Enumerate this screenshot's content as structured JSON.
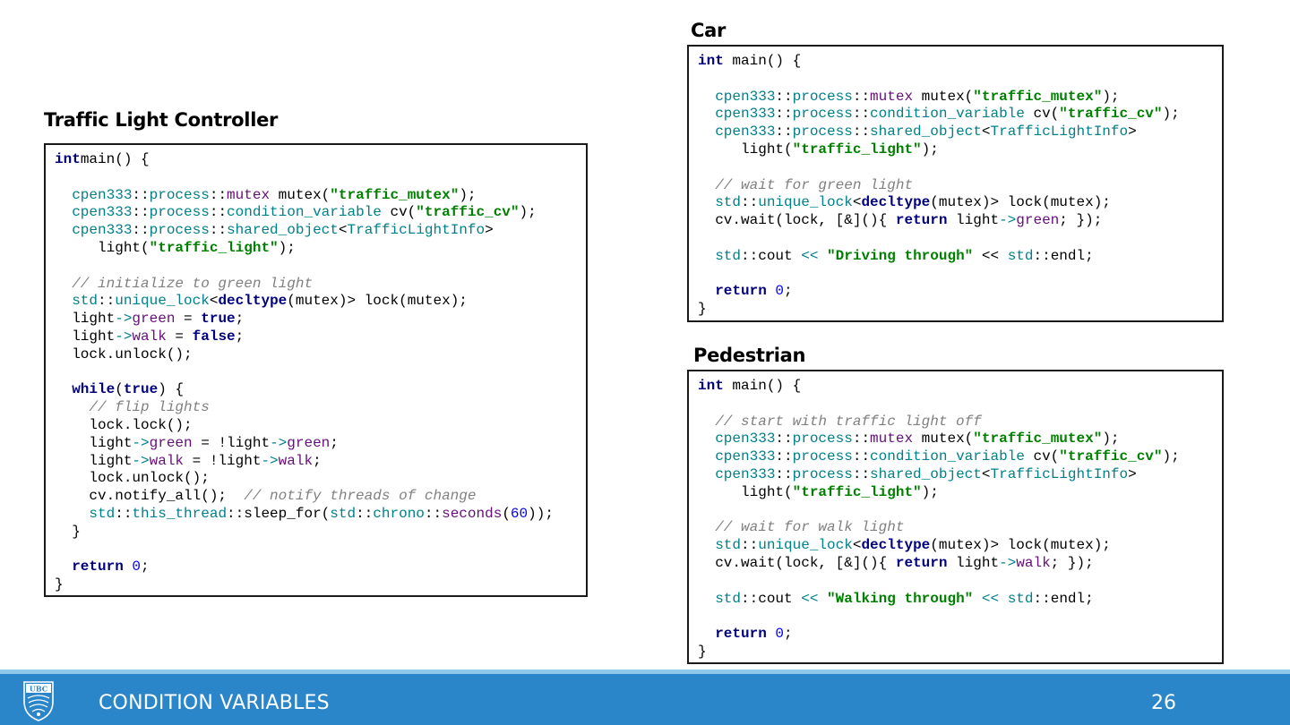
{
  "panels": {
    "controller": {
      "title": "Traffic Light Controller"
    },
    "car": {
      "title": "Car"
    },
    "pedestrian": {
      "title": "Pedestrian"
    }
  },
  "code": {
    "controller": [
      [
        [
          "kw",
          "int"
        ],
        [
          "",
          "main() {"
        ]
      ],
      [],
      [
        [
          "",
          "  "
        ],
        [
          "ns",
          "cpen333"
        ],
        [
          "",
          "::"
        ],
        [
          "ns",
          "process"
        ],
        [
          "",
          "::"
        ],
        [
          "mem",
          "mutex"
        ],
        [
          "",
          " mutex("
        ],
        [
          "str",
          "\"traffic_mutex\""
        ],
        [
          "",
          ");"
        ]
      ],
      [
        [
          "",
          "  "
        ],
        [
          "ns",
          "cpen333"
        ],
        [
          "",
          "::"
        ],
        [
          "ns",
          "process"
        ],
        [
          "",
          "::"
        ],
        [
          "ns",
          "condition_variable"
        ],
        [
          "",
          " cv("
        ],
        [
          "str",
          "\"traffic_cv\""
        ],
        [
          "",
          ");"
        ]
      ],
      [
        [
          "",
          "  "
        ],
        [
          "ns",
          "cpen333"
        ],
        [
          "",
          "::"
        ],
        [
          "ns",
          "process"
        ],
        [
          "",
          "::"
        ],
        [
          "ns",
          "shared_object"
        ],
        [
          "",
          "<"
        ],
        [
          "ns",
          "TrafficLightInfo"
        ],
        [
          "",
          ">"
        ]
      ],
      [
        [
          "",
          "     light("
        ],
        [
          "str",
          "\"traffic_light\""
        ],
        [
          "",
          ");"
        ]
      ],
      [],
      [
        [
          "",
          "  "
        ],
        [
          "cmt",
          "// initialize to green light"
        ]
      ],
      [
        [
          "",
          "  "
        ],
        [
          "ns",
          "std"
        ],
        [
          "",
          "::"
        ],
        [
          "ns",
          "unique_lock"
        ],
        [
          "",
          "<"
        ],
        [
          "kw",
          "decltype"
        ],
        [
          "",
          "(mutex)> lock(mutex);"
        ]
      ],
      [
        [
          "",
          "  light"
        ],
        [
          "op",
          "->"
        ],
        [
          "mem",
          "green"
        ],
        [
          "",
          " = "
        ],
        [
          "kw",
          "true"
        ],
        [
          "",
          ";"
        ]
      ],
      [
        [
          "",
          "  light"
        ],
        [
          "op",
          "->"
        ],
        [
          "mem",
          "walk"
        ],
        [
          "",
          " = "
        ],
        [
          "kw",
          "false"
        ],
        [
          "",
          ";"
        ]
      ],
      [
        [
          "",
          "  lock.unlock();"
        ]
      ],
      [],
      [
        [
          "",
          "  "
        ],
        [
          "kw",
          "while"
        ],
        [
          "",
          "("
        ],
        [
          "kw",
          "true"
        ],
        [
          "",
          ") {"
        ]
      ],
      [
        [
          "",
          "    "
        ],
        [
          "cmt",
          "// flip lights"
        ]
      ],
      [
        [
          "",
          "    lock.lock();"
        ]
      ],
      [
        [
          "",
          "    light"
        ],
        [
          "op",
          "->"
        ],
        [
          "mem",
          "green"
        ],
        [
          "",
          " = !light"
        ],
        [
          "op",
          "->"
        ],
        [
          "mem",
          "green"
        ],
        [
          "",
          ";"
        ]
      ],
      [
        [
          "",
          "    light"
        ],
        [
          "op",
          "->"
        ],
        [
          "mem",
          "walk"
        ],
        [
          "",
          " = !light"
        ],
        [
          "op",
          "->"
        ],
        [
          "mem",
          "walk"
        ],
        [
          "",
          ";"
        ]
      ],
      [
        [
          "",
          "    lock.unlock();"
        ]
      ],
      [
        [
          "",
          "    cv.notify_all();  "
        ],
        [
          "cmt",
          "// notify threads of change"
        ]
      ],
      [
        [
          "",
          "    "
        ],
        [
          "ns",
          "std"
        ],
        [
          "",
          "::"
        ],
        [
          "ns",
          "this_thread"
        ],
        [
          "",
          "::sleep_for("
        ],
        [
          "ns",
          "std"
        ],
        [
          "",
          "::"
        ],
        [
          "ns",
          "chrono"
        ],
        [
          "",
          "::"
        ],
        [
          "mem",
          "seconds"
        ],
        [
          "",
          "("
        ],
        [
          "num",
          "60"
        ],
        [
          "",
          "));"
        ]
      ],
      [
        [
          "",
          "  }"
        ]
      ],
      [],
      [
        [
          "",
          "  "
        ],
        [
          "kw",
          "return"
        ],
        [
          "",
          " "
        ],
        [
          "num",
          "0"
        ],
        [
          "",
          ";"
        ]
      ],
      [
        [
          "",
          "}"
        ]
      ]
    ],
    "car": [
      [
        [
          "kw",
          "int"
        ],
        [
          "",
          " main() {"
        ]
      ],
      [],
      [
        [
          "",
          "  "
        ],
        [
          "ns",
          "cpen333"
        ],
        [
          "",
          "::"
        ],
        [
          "ns",
          "process"
        ],
        [
          "",
          "::"
        ],
        [
          "mem",
          "mutex"
        ],
        [
          "",
          " mutex("
        ],
        [
          "str",
          "\"traffic_mutex\""
        ],
        [
          "",
          ");"
        ]
      ],
      [
        [
          "",
          "  "
        ],
        [
          "ns",
          "cpen333"
        ],
        [
          "",
          "::"
        ],
        [
          "ns",
          "process"
        ],
        [
          "",
          "::"
        ],
        [
          "ns",
          "condition_variable"
        ],
        [
          "",
          " cv("
        ],
        [
          "str",
          "\"traffic_cv\""
        ],
        [
          "",
          ");"
        ]
      ],
      [
        [
          "",
          "  "
        ],
        [
          "ns",
          "cpen333"
        ],
        [
          "",
          "::"
        ],
        [
          "ns",
          "process"
        ],
        [
          "",
          "::"
        ],
        [
          "ns",
          "shared_object"
        ],
        [
          "",
          "<"
        ],
        [
          "ns",
          "TrafficLightInfo"
        ],
        [
          "",
          ">"
        ]
      ],
      [
        [
          "",
          "     light("
        ],
        [
          "str",
          "\"traffic_light\""
        ],
        [
          "",
          ");"
        ]
      ],
      [],
      [
        [
          "",
          "  "
        ],
        [
          "cmt",
          "// wait for green light"
        ]
      ],
      [
        [
          "",
          "  "
        ],
        [
          "ns",
          "std"
        ],
        [
          "",
          "::"
        ],
        [
          "ns",
          "unique_lock"
        ],
        [
          "",
          "<"
        ],
        [
          "kw",
          "decltype"
        ],
        [
          "",
          "(mutex)> lock(mutex);"
        ]
      ],
      [
        [
          "",
          "  cv.wait(lock, [&](){ "
        ],
        [
          "kw",
          "return"
        ],
        [
          "",
          " light"
        ],
        [
          "op",
          "->"
        ],
        [
          "mem",
          "green"
        ],
        [
          "",
          "; });"
        ]
      ],
      [],
      [
        [
          "",
          "  "
        ],
        [
          "ns",
          "std"
        ],
        [
          "",
          "::cout "
        ],
        [
          "op",
          "<<"
        ],
        [
          "",
          " "
        ],
        [
          "str",
          "\"Driving through\""
        ],
        [
          "",
          " << "
        ],
        [
          "ns",
          "std"
        ],
        [
          "",
          "::endl;"
        ]
      ],
      [],
      [
        [
          "",
          "  "
        ],
        [
          "kw",
          "return"
        ],
        [
          "",
          " "
        ],
        [
          "num",
          "0"
        ],
        [
          "",
          ";"
        ]
      ],
      [
        [
          "",
          "}"
        ]
      ]
    ],
    "pedestrian": [
      [
        [
          "kw",
          "int"
        ],
        [
          "",
          " main() {"
        ]
      ],
      [],
      [
        [
          "",
          "  "
        ],
        [
          "cmt",
          "// start with traffic light off"
        ]
      ],
      [
        [
          "",
          "  "
        ],
        [
          "ns",
          "cpen333"
        ],
        [
          "",
          "::"
        ],
        [
          "ns",
          "process"
        ],
        [
          "",
          "::"
        ],
        [
          "mem",
          "mutex"
        ],
        [
          "",
          " mutex("
        ],
        [
          "str",
          "\"traffic_mutex\""
        ],
        [
          "",
          ");"
        ]
      ],
      [
        [
          "",
          "  "
        ],
        [
          "ns",
          "cpen333"
        ],
        [
          "",
          "::"
        ],
        [
          "ns",
          "process"
        ],
        [
          "",
          "::"
        ],
        [
          "ns",
          "condition_variable"
        ],
        [
          "",
          " cv("
        ],
        [
          "str",
          "\"traffic_cv\""
        ],
        [
          "",
          ");"
        ]
      ],
      [
        [
          "",
          "  "
        ],
        [
          "ns",
          "cpen333"
        ],
        [
          "",
          "::"
        ],
        [
          "ns",
          "process"
        ],
        [
          "",
          "::"
        ],
        [
          "ns",
          "shared_object"
        ],
        [
          "",
          "<"
        ],
        [
          "ns",
          "TrafficLightInfo"
        ],
        [
          "",
          ">"
        ]
      ],
      [
        [
          "",
          "     light("
        ],
        [
          "str",
          "\"traffic_light\""
        ],
        [
          "",
          ");"
        ]
      ],
      [],
      [
        [
          "",
          "  "
        ],
        [
          "cmt",
          "// wait for walk light"
        ]
      ],
      [
        [
          "",
          "  "
        ],
        [
          "ns",
          "std"
        ],
        [
          "",
          "::"
        ],
        [
          "ns",
          "unique_lock"
        ],
        [
          "",
          "<"
        ],
        [
          "kw",
          "decltype"
        ],
        [
          "",
          "(mutex)> lock(mutex);"
        ]
      ],
      [
        [
          "",
          "  cv.wait(lock, [&](){ "
        ],
        [
          "kw",
          "return"
        ],
        [
          "",
          " light"
        ],
        [
          "op",
          "->"
        ],
        [
          "mem",
          "walk"
        ],
        [
          "",
          "; });"
        ]
      ],
      [],
      [
        [
          "",
          "  "
        ],
        [
          "ns",
          "std"
        ],
        [
          "",
          "::cout "
        ],
        [
          "op",
          "<<"
        ],
        [
          "",
          " "
        ],
        [
          "str",
          "\"Walking through\""
        ],
        [
          "",
          " "
        ],
        [
          "op",
          "<<"
        ],
        [
          "",
          " "
        ],
        [
          "ns",
          "std"
        ],
        [
          "",
          "::endl;"
        ]
      ],
      [],
      [
        [
          "",
          "  "
        ],
        [
          "kw",
          "return"
        ],
        [
          "",
          " "
        ],
        [
          "num",
          "0"
        ],
        [
          "",
          ";"
        ]
      ],
      [
        [
          "",
          "}"
        ]
      ]
    ]
  },
  "footer": {
    "logo_text": "UBC",
    "title": "CONDITION VARIABLES",
    "page_number": "26",
    "bar_color": "#2a86c9",
    "stripe_color": "#8fc8ea"
  }
}
